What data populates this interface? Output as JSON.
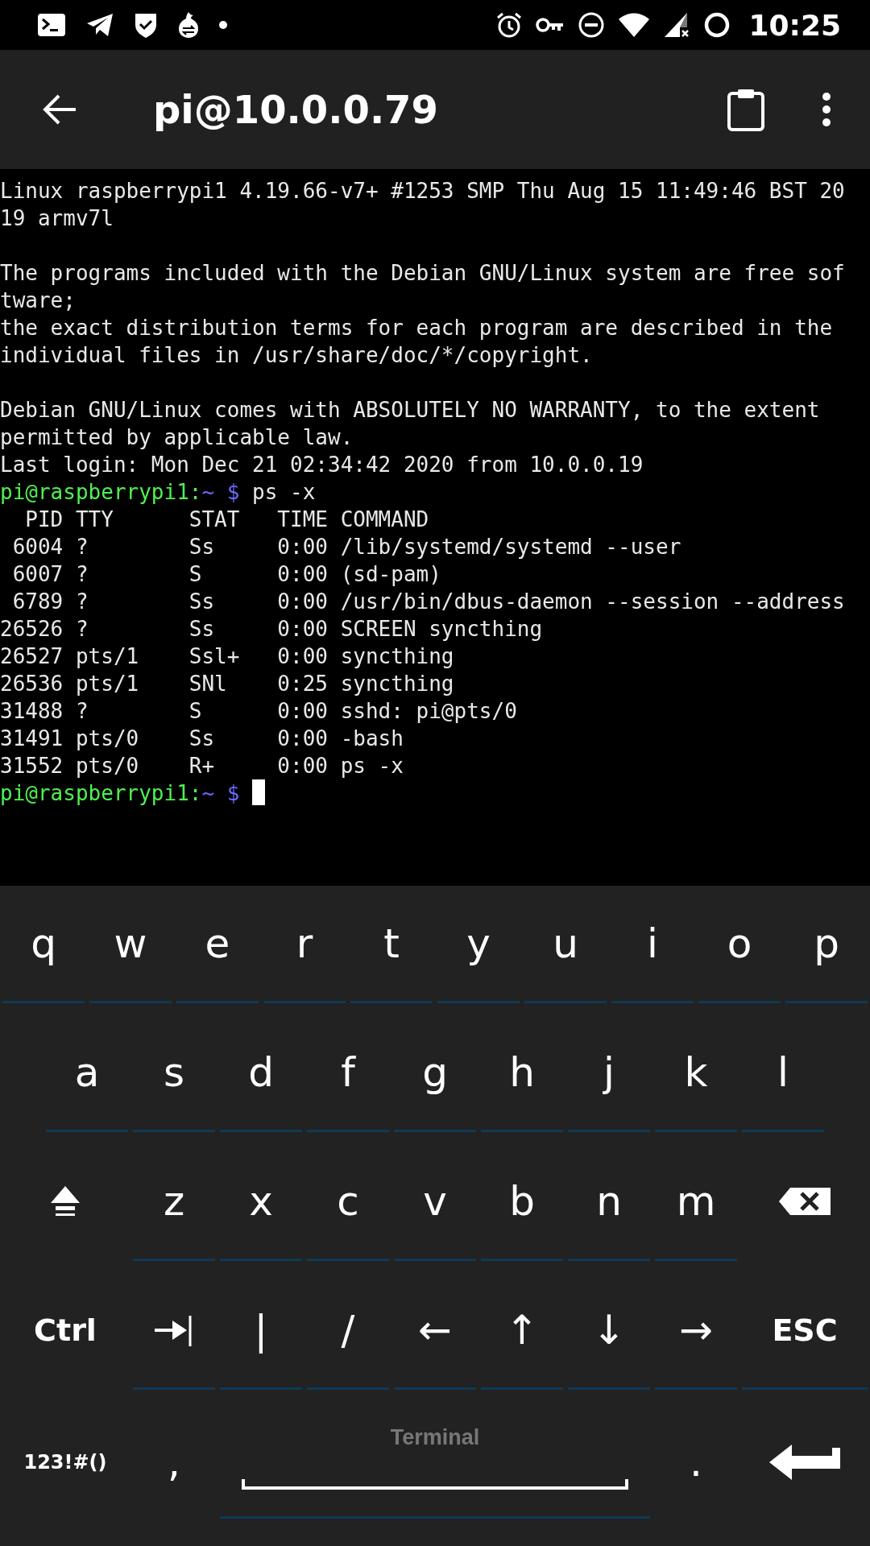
{
  "status_bar": {
    "time": "10:25"
  },
  "app_bar": {
    "title": "pi@10.0.0.79"
  },
  "terminal": {
    "lines": [
      {
        "kind": "output",
        "text": "Linux raspberrypi1 4.19.66-v7+ #1253 SMP Thu Aug 15 11:49:46 BST 20"
      },
      {
        "kind": "output",
        "text": "19 armv7l"
      },
      {
        "kind": "blank"
      },
      {
        "kind": "output",
        "text": "The programs included with the Debian GNU/Linux system are free sof"
      },
      {
        "kind": "output",
        "text": "tware;"
      },
      {
        "kind": "output",
        "text": "the exact distribution terms for each program are described in the"
      },
      {
        "kind": "output",
        "text": "individual files in /usr/share/doc/*/copyright."
      },
      {
        "kind": "blank"
      },
      {
        "kind": "output",
        "text": "Debian GNU/Linux comes with ABSOLUTELY NO WARRANTY, to the extent"
      },
      {
        "kind": "output",
        "text": "permitted by applicable law."
      },
      {
        "kind": "output",
        "text": "Last login: Mon Dec 21 02:34:42 2020 from 10.0.0.19"
      },
      {
        "kind": "prompt",
        "host": "pi@raspberrypi1:",
        "path": "~ $",
        "command": "ps -x"
      },
      {
        "kind": "output",
        "text": "  PID TTY      STAT   TIME COMMAND"
      },
      {
        "kind": "output",
        "text": " 6004 ?        Ss     0:00 /lib/systemd/systemd --user"
      },
      {
        "kind": "output",
        "text": " 6007 ?        S      0:00 (sd-pam)"
      },
      {
        "kind": "output",
        "text": " 6789 ?        Ss     0:00 /usr/bin/dbus-daemon --session --address"
      },
      {
        "kind": "output",
        "text": "26526 ?        Ss     0:00 SCREEN syncthing"
      },
      {
        "kind": "output",
        "text": "26527 pts/1    Ssl+   0:00 syncthing"
      },
      {
        "kind": "output",
        "text": "26536 pts/1    SNl    0:25 syncthing"
      },
      {
        "kind": "output",
        "text": "31488 ?        S      0:00 sshd: pi@pts/0"
      },
      {
        "kind": "output",
        "text": "31491 pts/0    Ss     0:00 -bash"
      },
      {
        "kind": "output",
        "text": "31552 pts/0    R+     0:00 ps -x"
      },
      {
        "kind": "prompt",
        "host": "pi@raspberrypi1:",
        "path": "~ $",
        "cursor": true
      }
    ]
  },
  "keyboard": {
    "rows": [
      {
        "keys": [
          {
            "kind": "char",
            "label": "q"
          },
          {
            "kind": "char",
            "label": "w"
          },
          {
            "kind": "char",
            "label": "e"
          },
          {
            "kind": "char",
            "label": "r"
          },
          {
            "kind": "char",
            "label": "t"
          },
          {
            "kind": "char",
            "label": "y"
          },
          {
            "kind": "char",
            "label": "u"
          },
          {
            "kind": "char",
            "label": "i"
          },
          {
            "kind": "char",
            "label": "o"
          },
          {
            "kind": "char",
            "label": "p"
          }
        ]
      },
      {
        "keys": [
          {
            "kind": "char",
            "label": "a"
          },
          {
            "kind": "char",
            "label": "s"
          },
          {
            "kind": "char",
            "label": "d"
          },
          {
            "kind": "char",
            "label": "f"
          },
          {
            "kind": "char",
            "label": "g"
          },
          {
            "kind": "char",
            "label": "h"
          },
          {
            "kind": "char",
            "label": "j"
          },
          {
            "kind": "char",
            "label": "k"
          },
          {
            "kind": "char",
            "label": "l"
          }
        ]
      },
      {
        "keys": [
          {
            "kind": "shift"
          },
          {
            "kind": "char",
            "label": "z"
          },
          {
            "kind": "char",
            "label": "x"
          },
          {
            "kind": "char",
            "label": "c"
          },
          {
            "kind": "char",
            "label": "v"
          },
          {
            "kind": "char",
            "label": "b"
          },
          {
            "kind": "char",
            "label": "n"
          },
          {
            "kind": "char",
            "label": "m"
          },
          {
            "kind": "backspace"
          }
        ]
      },
      {
        "keys": [
          {
            "kind": "mod",
            "label": "Ctrl"
          },
          {
            "kind": "tab"
          },
          {
            "kind": "char",
            "label": "|"
          },
          {
            "kind": "char",
            "label": "/"
          },
          {
            "kind": "char",
            "label": "←"
          },
          {
            "kind": "char",
            "label": "↑"
          },
          {
            "kind": "char",
            "label": "↓"
          },
          {
            "kind": "char",
            "label": "→"
          },
          {
            "kind": "mod",
            "label": "ESC",
            "underlined": true
          }
        ]
      },
      {
        "keys": [
          {
            "kind": "mod",
            "label": "123!#()"
          },
          {
            "kind": "char",
            "label": ","
          },
          {
            "kind": "space",
            "label": "Terminal"
          },
          {
            "kind": "char",
            "label": "."
          },
          {
            "kind": "enter"
          }
        ]
      }
    ]
  }
}
